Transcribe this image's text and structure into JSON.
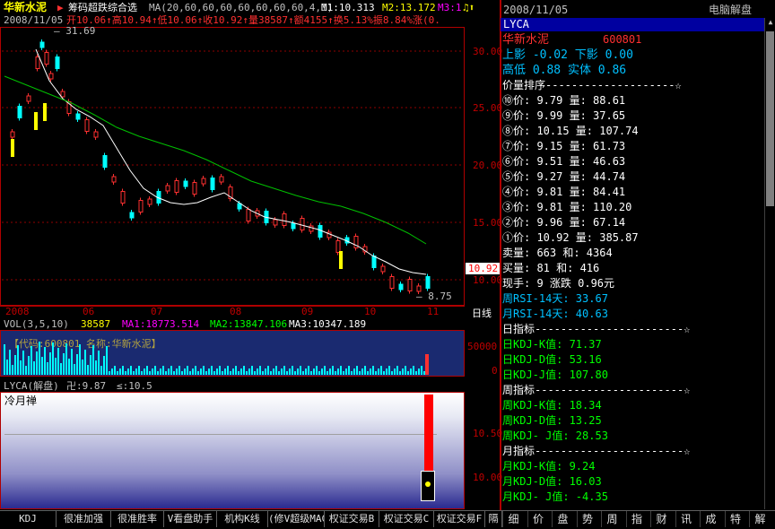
{
  "header": {
    "stock_name": "华新水泥",
    "indicator_name": "筹码超跌综合选",
    "ma_params": "MA(20,60,60,60,60,60,60,60,4,1)",
    "m1": "M1:10.313",
    "m2": "M2:13.172",
    "m3": "M3:1",
    "date": "2008/11/05",
    "quote": "开10.06↑高10.94↑低10.06↑收10.92↑量38587↑额4155↑换5.13%振8.84%涨(0.",
    "high_mark": "31.69",
    "low_mark": "8.75",
    "last_price": "10.92"
  },
  "price_axis": [
    "30.00",
    "25.00",
    "20.00",
    "15.00",
    "10.00"
  ],
  "date_axis": [
    "2008",
    "06",
    "07",
    "08",
    "09",
    "10",
    "11",
    "日线"
  ],
  "volume": {
    "label": "VOL(3,5,10)",
    "v": "38587",
    "ma1": "MA1:18773.514",
    "ma2": "MA2:13847.106",
    "ma3": "MA3:10347.189",
    "code_text": "【代码:600801 名称:华新水泥】",
    "axis": [
      "50000",
      "0"
    ]
  },
  "lyca": {
    "label": "LYCA(解盘)",
    "v1": "卍:9.87",
    "v2": "≤:10.5",
    "tag": "冷月禅",
    "axis": [
      "10.50",
      "10.00"
    ]
  },
  "bottom_tabs": [
    "KDJ",
    "很准加强",
    "很准胜率",
    "V看盘助手",
    "机构K线",
    "(修V超级MACD)",
    "权证交易B",
    "权证交易C",
    "权证交易F",
    "隔"
  ],
  "right_tabs": [
    "细",
    "价",
    "盘",
    "势",
    "周",
    "指",
    "财",
    "讯",
    "成",
    "特",
    "解"
  ],
  "panel": {
    "date": "2008/11/05",
    "title": "电脑解盘",
    "bar": "LYCA",
    "name": "华新水泥",
    "code": "600801",
    "row1": "上影 -0.02  下影 0.00",
    "row2": "高低  0.88  实体  0.86",
    "sort_header": "价量排序--------------------☆",
    "sort_rows": [
      "⑩价: 9.79 量: 88.61",
      "⑨价: 9.99 量: 37.65",
      "⑧价: 10.15 量: 107.74",
      "⑦价: 9.15 量: 61.73",
      "⑥价: 9.51 量: 46.63",
      "⑤价: 9.27 量: 44.74",
      "④价: 9.81 量: 84.41",
      "③价: 9.81 量: 110.20",
      "②价: 9.96 量: 67.14",
      "①价: 10.92 量: 385.87"
    ],
    "sell": "卖量: 663 和: 4364",
    "buy": "买量: 81 和: 416",
    "now": "现手:   9  涨跌  0.96元",
    "rsi_week": "周RSI-14天:  33.67",
    "rsi_month": "月RSI-14天:  40.63",
    "day_header": "日指标-----------------------☆",
    "day_k": "日KDJ-K值:  71.37",
    "day_d": "日KDJ-D值:  53.16",
    "day_j": "日KDJ-J值:  107.80",
    "week_header": "周指标-----------------------☆",
    "week_k": "周KDJ-K值:  18.34",
    "week_d": "周KDJ-D值:  13.25",
    "week_j": "周KDJ- J值:  28.53",
    "month_header": "月指标-----------------------☆",
    "month_k": "月KDJ-K值:  9.24",
    "month_d": "月KDJ-D值:  16.03",
    "month_j": "月KDJ- J值:  -4.35"
  },
  "colors": {
    "up": "#ff3030",
    "down": "#00ffff",
    "ma1": "#ffffff",
    "ma2": "#00d000",
    "yellow": "#ffff00",
    "green": "#00ff00",
    "cyan": "#00c0ff"
  }
}
